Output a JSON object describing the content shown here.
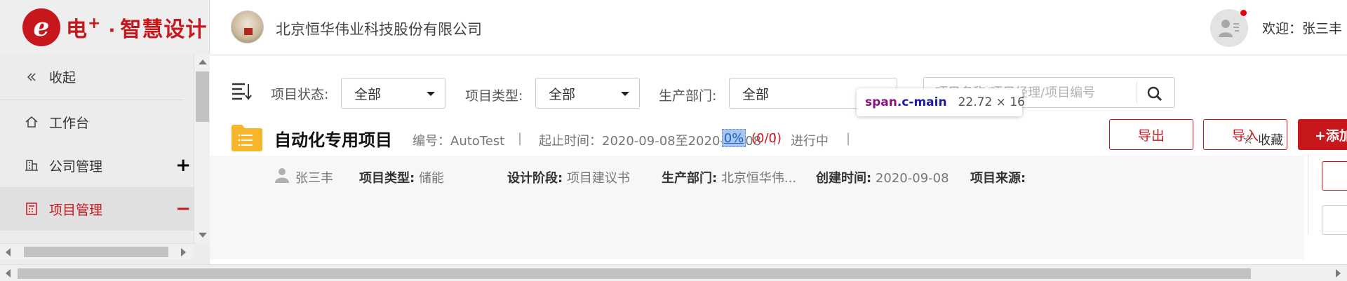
{
  "brand": {
    "logo_letter": "e",
    "name_main": "电",
    "name_plus": "+",
    "dot": "·",
    "name_tail": "智慧设计"
  },
  "header": {
    "company": "北京恒华伟业科技股份有限公司",
    "welcome": "欢迎：张三丰",
    "notification_color": "#e60012"
  },
  "sidebar": {
    "collapse_label": "收起",
    "items": [
      {
        "label": "工作台",
        "icon": "home-icon",
        "sign": ""
      },
      {
        "label": "公司管理",
        "icon": "building-icon",
        "sign": "+"
      },
      {
        "label": "项目管理",
        "icon": "calculator-icon",
        "sign": "−",
        "active": true
      }
    ]
  },
  "filters": {
    "status_label": "项目状态:",
    "status_value": "全部",
    "type_label": "项目类型:",
    "type_value": "全部",
    "dept_label": "生产部门:",
    "dept_value": "全部",
    "search_placeholder": "项目名称/项目经理/项目编号"
  },
  "actions": {
    "export": "导出",
    "import": "导入",
    "add": "+添加"
  },
  "project": {
    "title": "自动化专用项目",
    "code": "编号：AutoTest",
    "period": "起止时间：2020-09-08至2020-09-08",
    "status": "进行中",
    "progress": "0%",
    "counts": "(0/0)",
    "favorite": "收藏",
    "manager": "张三丰",
    "type_label": "项目类型:",
    "type_value": "储能",
    "stage_label": "设计阶段:",
    "stage_value": "项目建议书",
    "dept_label": "生产部门:",
    "dept_value": "北京恒华伟...",
    "created_label": "创建时间:",
    "created_value": "2020-09-08",
    "source_label": "项目来源:",
    "source_value": ""
  },
  "tooltip": {
    "tag": "span",
    "cls": ".c-main",
    "size": "22.72 × 16"
  },
  "colors": {
    "accent": "#c8161d"
  }
}
